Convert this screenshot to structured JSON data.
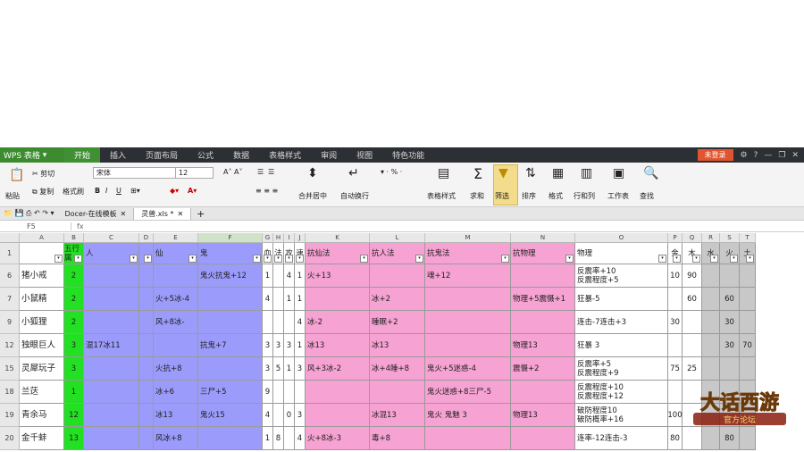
{
  "app": {
    "title": "WPS 表格"
  },
  "menu": [
    "开始",
    "插入",
    "页面布局",
    "公式",
    "数据",
    "表格样式",
    "审阅",
    "视图",
    "特色功能"
  ],
  "login_label": "未登录",
  "ribbon": {
    "cut": "剪切",
    "paste": "粘贴",
    "copy": "复制",
    "format_painter": "格式刷",
    "font_name": "宋体",
    "font_size": "12",
    "merge": "合并居中",
    "wrap": "自动换行",
    "percent": "%",
    "cond_format": "表格样式",
    "sum": "求和",
    "filter": "筛选",
    "sort": "排序",
    "format": "格式",
    "rowcol": "行和列",
    "sheet": "工作表",
    "find": "查找"
  },
  "tabs": [
    {
      "label": "Docer-在线模板"
    },
    {
      "label": "灵兽.xls *"
    }
  ],
  "formula": {
    "cell_ref": "F5",
    "fx": "fx"
  },
  "columns": [
    "A",
    "B",
    "C",
    "D",
    "E",
    "F",
    "G",
    "H",
    "I",
    "J",
    "K",
    "L",
    "M",
    "N",
    "O",
    "P",
    "Q",
    "R",
    "S",
    "T"
  ],
  "header_row": {
    "row_num": "1",
    "cells": [
      "",
      "五行属",
      "人",
      "",
      "仙",
      "鬼",
      "血",
      "法",
      "攻",
      "速",
      "抗仙法",
      "抗人法",
      "抗鬼法",
      "抗物理",
      "物理",
      "金",
      "木",
      "水",
      "火",
      "土"
    ]
  },
  "rows": [
    {
      "num": "6",
      "cells": [
        "猪小戒",
        "2",
        "",
        "",
        "",
        "鬼火抗鬼+12",
        "1",
        "",
        "4",
        "1",
        "火+13",
        "",
        "魂+12",
        "",
        "反震率+10\n反震程度+5",
        "10",
        "90",
        "",
        "",
        ""
      ]
    },
    {
      "num": "7",
      "cells": [
        "小鼠精",
        "2",
        "",
        "",
        "火+5冰-4",
        "",
        "4",
        "",
        "1",
        "1",
        "",
        "冰+2",
        "",
        "物理+5震慑+1",
        "狂暴-5",
        "",
        "60",
        "",
        "60",
        ""
      ]
    },
    {
      "num": "9",
      "cells": [
        "小狐狸",
        "2",
        "",
        "",
        "风+8冰-",
        "",
        "",
        "",
        "",
        "4",
        "冰-2",
        "睡眠+2",
        "",
        "",
        "连击-7连击+3",
        "30",
        "",
        "",
        "30",
        ""
      ]
    },
    {
      "num": "12",
      "cells": [
        "独眼巨人",
        "3",
        "混17冰11",
        "",
        "",
        "抗鬼+7",
        "3",
        "3",
        "3",
        "1",
        "冰13",
        "冰13",
        "",
        "物理13",
        "狂暴 3",
        "",
        "",
        "",
        "30",
        "70"
      ]
    },
    {
      "num": "15",
      "cells": [
        "灵犀玩子",
        "3",
        "",
        "",
        "火抗+8",
        "",
        "3",
        "5",
        "1",
        "3",
        "风+3冰-2",
        "冰+4睡+8",
        "鬼火+5迷惑-4",
        "震慑+2",
        "反震率+5\n反震程度+9",
        "75",
        "25",
        "",
        "",
        ""
      ]
    },
    {
      "num": "18",
      "cells": [
        "兰荙",
        "1",
        "",
        "",
        "冰+6",
        "三尸+5",
        "9",
        "",
        "",
        "",
        "",
        "",
        "鬼火迷惑+8三尸-5",
        "",
        "反震程度+10\n反震程度+12",
        "",
        "",
        "",
        "",
        ""
      ]
    },
    {
      "num": "19",
      "cells": [
        "青余马",
        "12",
        "",
        "",
        "冰13",
        "鬼火15",
        "4",
        "",
        "0",
        "3",
        "",
        "冰混13",
        "鬼火 鬼魅 3",
        "物理13",
        "破防程度10\n破防概率+16",
        "100",
        "",
        "",
        "",
        ""
      ]
    },
    {
      "num": "20",
      "cells": [
        "金千蚌",
        "13",
        "",
        "",
        "风冰+8",
        "",
        "1",
        "8",
        "",
        "4",
        "火+8冰-3",
        "毒+8",
        "",
        "",
        "连率-12连击-3",
        "80",
        "",
        "",
        "80",
        ""
      ]
    }
  ],
  "watermark": {
    "title": "大话西游",
    "subtitle": "官方论坛"
  }
}
